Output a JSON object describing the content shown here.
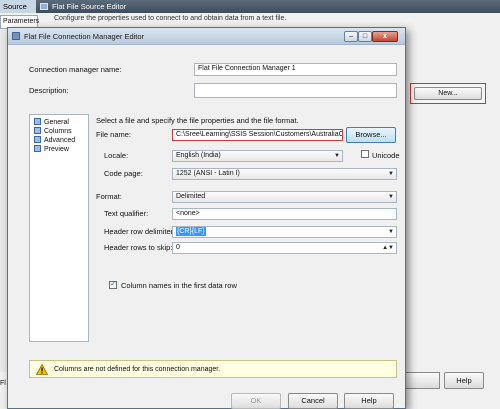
{
  "background_window": {
    "tab_label": "Source",
    "title": "Flat File Source Editor",
    "parameters_tab": "Parameters",
    "description": "Configure the properties used to connect to and obtain data from a text file.",
    "new_button": "New...",
    "bottom_left_text": "Fl",
    "help_button": "Help"
  },
  "dialog": {
    "title": "Flat File Connection Manager Editor",
    "caption_buttons": {
      "minimize": "–",
      "maximize": "□",
      "close": "x"
    },
    "connection_manager_name_label": "Connection manager name:",
    "connection_manager_name_value": "Flat File Connection Manager 1",
    "description_label": "Description:",
    "description_value": "",
    "nav_items": [
      {
        "label": "General",
        "icon": "general-page-icon"
      },
      {
        "label": "Columns",
        "icon": "columns-page-icon"
      },
      {
        "label": "Advanced",
        "icon": "advanced-page-icon"
      },
      {
        "label": "Preview",
        "icon": "preview-page-icon"
      }
    ],
    "intro_text": "Select a file and specify the file properties and the file format.",
    "file_name_label": "File name:",
    "file_name_value": "C:\\Sree\\Learning\\SSIS Session\\Customers\\AustraliaCu",
    "browse_button": "Browse...",
    "locale_label": "Locale:",
    "locale_value": "English (India)",
    "unicode_label": "Unicode",
    "code_page_label": "Code page:",
    "code_page_value": "1252  (ANSI - Latin I)",
    "format_label": "Format:",
    "format_value": "Delimited",
    "text_qualifier_label": "Text qualifier:",
    "text_qualifier_value": "<none>",
    "header_row_delimiter_label": "Header row delimiter:",
    "header_row_delimiter_value": "{CR}{LF}",
    "header_rows_to_skip_label": "Header rows to skip:",
    "header_rows_to_skip_value": "0",
    "column_names_label": "Column names in the first data row",
    "column_names_checked": true,
    "warning_text": "Columns are not defined for this connection manager.",
    "ok_button": "OK",
    "cancel_button": "Cancel",
    "help_button": "Help"
  },
  "colors": {
    "highlight_border": "#d33a3a",
    "selection": "#3399ff",
    "warning_background": "#ffffe1"
  }
}
